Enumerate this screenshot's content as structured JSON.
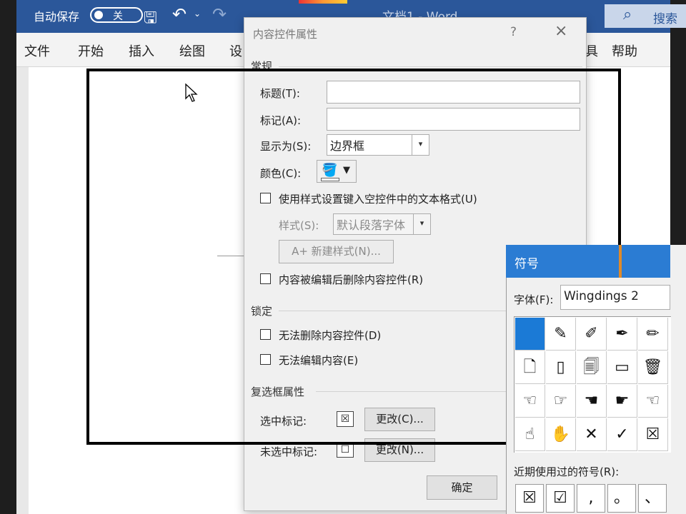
{
  "word": {
    "autosave_label": "自动保存",
    "autosave_state": "关",
    "doc_title": "文档1 - Word",
    "search_placeholder": "搜索",
    "tabs": [
      "文件",
      "开始",
      "插入",
      "绘图",
      "设",
      "具",
      "帮助"
    ]
  },
  "dialog": {
    "title": "内容控件属性",
    "help": "?",
    "close": "×",
    "general_section": "常规",
    "title_label": "标题(T):",
    "tag_label": "标记(A):",
    "show_as_label": "显示为(S):",
    "show_as_value": "边界框",
    "color_label": "颜色(C):",
    "use_style_label": "使用样式设置键入空控件中的文本格式(U)",
    "style_label": "样式(S):",
    "style_value": "默认段落字体",
    "new_style_label": "A+ 新建样式(N)...",
    "remove_label": "内容被编辑后删除内容控件(R)",
    "lock_section": "锁定",
    "lock_delete_label": "无法删除内容控件(D)",
    "lock_edit_label": "无法编辑内容(E)",
    "checkbox_section": "复选框属性",
    "checked_label": "选中标记:",
    "checked_symbol": "☒",
    "change_checked": "更改(C)...",
    "unchecked_label": "未选中标记:",
    "unchecked_symbol": "☐",
    "change_unchecked": "更改(N)...",
    "ok": "确定"
  },
  "symbol_dialog": {
    "title": "符号",
    "font_label": "字体(F):",
    "font_value": "Wingdings 2",
    "grid": [
      [
        "",
        "✎",
        "✐",
        "✒",
        "✏"
      ],
      [
        "🗋",
        "▯",
        "🗐",
        "▭",
        "🗑"
      ],
      [
        "☜",
        "☞",
        "☚",
        "☛",
        "☜"
      ],
      [
        "☝",
        "✋",
        "✕",
        "✓",
        "☒"
      ]
    ],
    "recent_label": "近期使用过的符号(R):",
    "recent": [
      "☒",
      "☑",
      ",",
      "。",
      "、"
    ]
  }
}
